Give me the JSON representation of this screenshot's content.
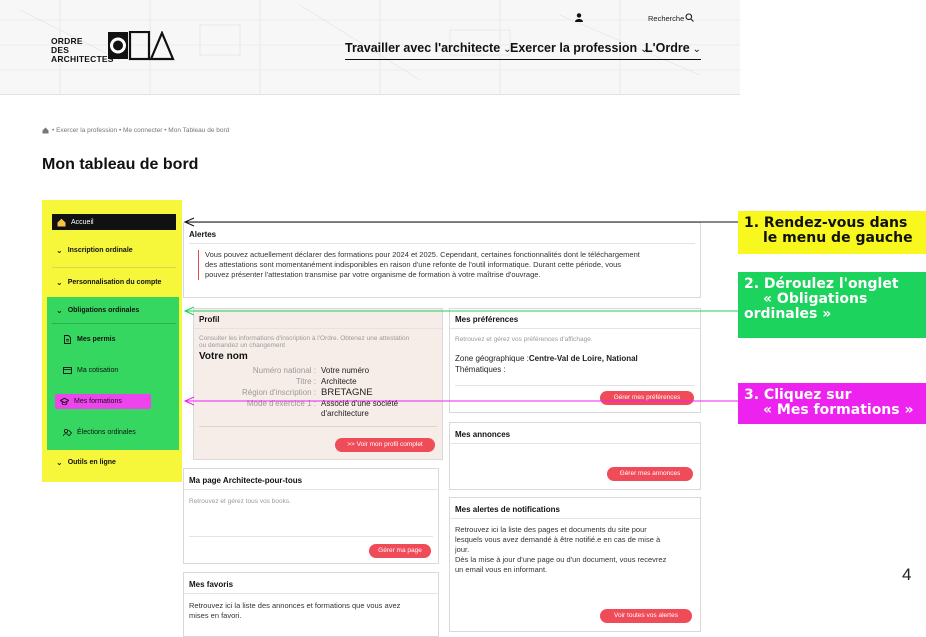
{
  "header": {
    "logo_lines": [
      "ORDRE",
      "DES",
      "ARCHITECTES"
    ],
    "search_label": "Recherche",
    "nav": [
      {
        "label": "Travailler avec l'architecte"
      },
      {
        "label": "Exercer la profession"
      },
      {
        "label": "L'Ordre"
      }
    ]
  },
  "breadcrumb": "• Exercer la profession • Me connecter • Mon Tableau de bord",
  "page_title": "Mon tableau de bord",
  "sidebar": {
    "active": "Accueil",
    "items": [
      "Inscription ordinale",
      "Personnalisation du compte",
      "Obligations ordinales",
      "Outils en ligne"
    ],
    "sub_items": [
      "Mes permis",
      "Ma cotisation",
      "Mes formations",
      "Élections ordinales"
    ]
  },
  "alertes": {
    "title": "Alertes",
    "text_lines": [
      "Vous pouvez actuellement déclarer des formations pour 2024 et 2025. Cependant, certaines fonctionnalités dont le téléchargement",
      "des attestations sont momentanément indisponibles en raison d'une refonte de l'outil informatique. Durant cette période, vous",
      "pouvez présenter l'attestation transmise par votre organisme de formation à votre maîtrise d'ouvrage."
    ]
  },
  "profil": {
    "title": "Profil",
    "hint": [
      "Consulter les informations d'inscription à l'Ordre. Obtenez une attestation",
      "ou demandez un changement"
    ],
    "name": "Votre nom",
    "rows": [
      {
        "label": "Numéro national :",
        "value": "Votre numéro"
      },
      {
        "label": "Titre :",
        "value": "Architecte"
      },
      {
        "label": "Région d'inscription :",
        "value": "BRETAGNE"
      },
      {
        "label": "Mode d'exercice 1 :",
        "value": "Associé d'une société"
      },
      {
        "label": "",
        "value": "d'architecture"
      }
    ],
    "button": ">> Voir mon profil complet"
  },
  "preferences": {
    "title": "Mes préférences",
    "hint": "Retrouvez et gérez vos préférences d'affichage.",
    "zone_label": "Zone géographique :",
    "zone_value": "Centre-Val de Loire, National",
    "thematiques": "Thématiques :",
    "button": "Gérer mes préférences"
  },
  "annonces": {
    "title": "Mes annonces",
    "button": "Gérer mes annonces"
  },
  "page_archi": {
    "title": "Ma page Architecte-pour-tous",
    "hint": "Retrouvez et gérez tous vos books.",
    "button": "Gérer ma page"
  },
  "notifications": {
    "title": "Mes alertes de notifications",
    "text_lines": [
      "Retrouvez ici la liste des pages et documents du site pour",
      "lesquels vous avez demandé à être notifié.e en cas de mise à",
      "jour.",
      "Dès la mise à jour d'une page ou d'un document, vous recevrez",
      "un email vous en informant."
    ],
    "button": "Voir toutes vos alertes"
  },
  "favoris": {
    "title": "Mes favoris",
    "text_lines": [
      "Retrouvez ici la liste des annonces et formations que vous avez",
      "mises en favori."
    ]
  },
  "callouts": [
    {
      "lines": [
        "1. Rendez-vous dans",
        "   le menu de gauche"
      ],
      "color": "#f8f81e",
      "text_color": "#111111"
    },
    {
      "lines": [
        "2. Déroulez l'onglet",
        "   « Obligations",
        "   ordinales »"
      ],
      "color": "#1bd35d",
      "text_color": "#ffffff"
    },
    {
      "lines": [
        "3. Cliquez sur",
        "   « Mes formations »"
      ],
      "color": "#ee22ee",
      "text_color": "#ffffff"
    }
  ],
  "page_number": "4",
  "colors": {
    "accent": "#ef4b59",
    "yellow": "#f6f63a",
    "green": "#36d760",
    "magenta": "#ee44ee"
  }
}
